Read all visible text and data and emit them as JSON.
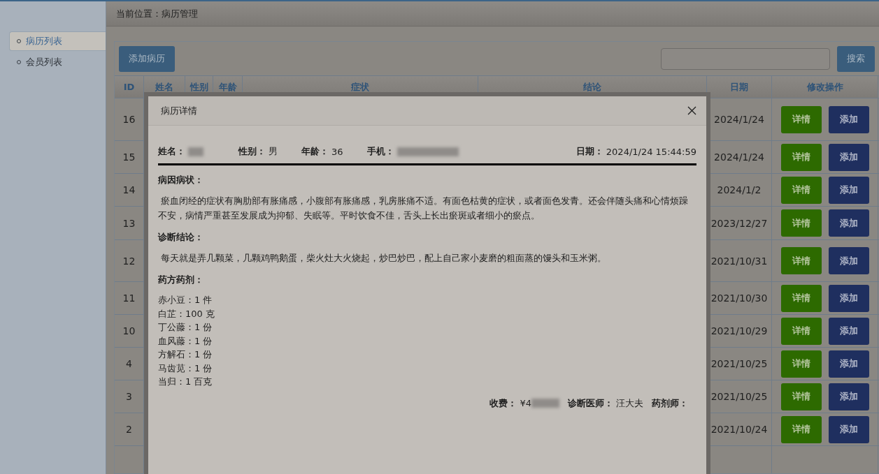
{
  "breadcrumb": {
    "label": "当前位置：",
    "value": "病历管理"
  },
  "sidebar": {
    "items": [
      {
        "label": "病历列表",
        "selected": true
      },
      {
        "label": "会员列表",
        "selected": false
      }
    ]
  },
  "toolbar": {
    "add_button": "添加病历",
    "search_button": "搜索"
  },
  "table": {
    "columns": [
      "ID",
      "姓名",
      "性别",
      "年龄",
      "症状",
      "结论",
      "日期",
      "修改操作"
    ],
    "rows": [
      {
        "id": "16",
        "date": "2024/1/24",
        "actions": [
          "详情",
          "添加"
        ]
      },
      {
        "id": "15",
        "date": "2024/1/24",
        "actions": [
          "详情",
          "添加"
        ]
      },
      {
        "id": "14",
        "date": "2024/1/2",
        "actions": [
          "详情",
          "添加"
        ]
      },
      {
        "id": "13",
        "date": "2023/12/27",
        "actions": [
          "详情",
          "添加"
        ]
      },
      {
        "id": "12",
        "date": "2021/10/31",
        "actions": [
          "详情",
          "添加"
        ]
      },
      {
        "id": "11",
        "date": "2021/10/30",
        "actions": [
          "详情",
          "添加"
        ]
      },
      {
        "id": "10",
        "date": "2021/10/29",
        "actions": [
          "详情",
          "添加"
        ]
      },
      {
        "id": "4",
        "date": "2021/10/25",
        "actions": [
          "详情",
          "添加"
        ]
      },
      {
        "id": "3",
        "date": "2021/10/25",
        "actions": [
          "详情",
          "添加"
        ]
      },
      {
        "id": "2",
        "date": "2021/10/24",
        "actions": [
          "详情",
          "添加"
        ]
      }
    ]
  },
  "modal": {
    "title": "病历详情",
    "fields": [
      {
        "label": "姓名：",
        "redacted": true
      },
      {
        "label": "性别：",
        "value": "男",
        "redacted": false
      },
      {
        "label": "年龄：",
        "value": "36",
        "redacted": false
      },
      {
        "label": "手机：",
        "redacted": true
      }
    ],
    "date": {
      "label": "日期：",
      "value": "2024/1/24 15:44:59"
    },
    "sections": [
      {
        "heading": "病因病状：",
        "kind": "paragraph",
        "text": " 瘀血闭经的症状有胸肋部有胀痛感，小腹部有胀痛感，乳房胀痛不适。有面色枯黄的症状，或者面色发青。还会伴随头痛和心情烦躁不安，病情严重甚至发展成为抑郁、失眠等。平时饮食不佳，舌头上长出瘀斑或者细小的瘀点。"
      },
      {
        "heading": "诊断结论：",
        "kind": "paragraph",
        "text": " 每天就是弄几颗菜，几颗鸡鸭鹅蛋，柴火灶大火烧起，炒巴炒巴，配上自己家小麦磨的粗面蒸的馒头和玉米粥。"
      },
      {
        "heading": "药方药剂：",
        "kind": "list",
        "items": [
          "赤小豆：1 件",
          "白芷：100 克",
          "丁公藤：1 份",
          "血风藤：1 份",
          "方解石：1 份",
          "马齿苋：1 份",
          "当归：1 百克"
        ]
      }
    ],
    "footer": [
      {
        "label": "收费：",
        "value": "¥4",
        "redacted": true
      },
      {
        "label": "诊断医师：",
        "value": "汪大夫",
        "redacted": false
      },
      {
        "label": "药剂师：",
        "redacted": false
      }
    ]
  }
}
